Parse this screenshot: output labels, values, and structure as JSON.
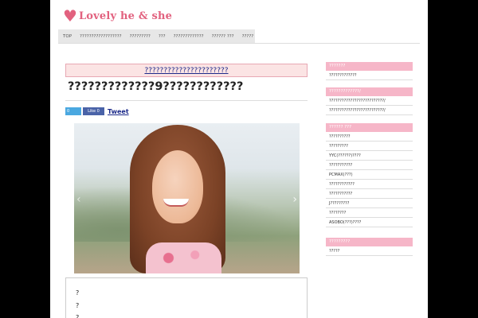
{
  "header": {
    "logo_text": "Lovely he & she",
    "top_link": "???"
  },
  "nav": [
    "TOP",
    "??????????????????",
    "?????????",
    "???",
    "?????????????",
    "?????? ???",
    "?????"
  ],
  "article": {
    "category": "??????????????????????",
    "title": "?????????????9????????????",
    "share_count": "0",
    "fb_label": "Like 0",
    "tweet_label": "Tweet",
    "bullets": [
      "?",
      "?",
      "?"
    ]
  },
  "sidebar": {
    "sections": [
      {
        "title": "???????",
        "items": [
          "?????????????"
        ]
      },
      {
        "title": "?????????????/",
        "items": [
          "??????????????????????????/",
          "??????????????????????????/"
        ]
      },
      {
        "title": "?????? ???",
        "items": [
          "??????????",
          "?????????",
          "YYC(??????)????",
          "???????????",
          "PCMAX(???)",
          "????????????",
          "???????????",
          "J?????????",
          "????????",
          "ASOBO(???)????"
        ]
      },
      {
        "title": "?????????",
        "items": [
          "?????"
        ]
      }
    ]
  },
  "colors": {
    "accent": "#e2627f",
    "link": "#1c2a8a",
    "sidebar_head": "#f6b6c8"
  }
}
